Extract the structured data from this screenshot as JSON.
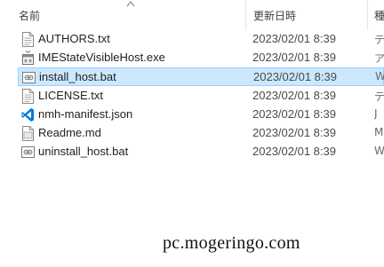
{
  "columns": {
    "name": "名前",
    "date": "更新日時",
    "type": "種"
  },
  "files": [
    {
      "name": "AUTHORS.txt",
      "date": "2023/02/01 8:39",
      "type": "テ",
      "icon": "text-file-icon",
      "selected": false
    },
    {
      "name": "IMEStateVisibleHost.exe",
      "date": "2023/02/01 8:39",
      "type": "ア",
      "icon": "exe-file-icon",
      "selected": false
    },
    {
      "name": "install_host.bat",
      "date": "2023/02/01 8:39",
      "type": "W",
      "icon": "bat-file-icon",
      "selected": true
    },
    {
      "name": "LICENSE.txt",
      "date": "2023/02/01 8:39",
      "type": "テ",
      "icon": "text-file-icon",
      "selected": false
    },
    {
      "name": "nmh-manifest.json",
      "date": "2023/02/01 8:39",
      "type": "J",
      "icon": "vscode-json-icon",
      "selected": false
    },
    {
      "name": "Readme.md",
      "date": "2023/02/01 8:39",
      "type": "M",
      "icon": "markdown-file-icon",
      "selected": false
    },
    {
      "name": "uninstall_host.bat",
      "date": "2023/02/01 8:39",
      "type": "W",
      "icon": "bat-file-icon",
      "selected": false
    }
  ],
  "watermark": "pc.mogeringo.com",
  "colors": {
    "selection_bg": "#cce8ff",
    "selection_border": "#99d1ff",
    "vscode_blue": "#0078d4"
  }
}
